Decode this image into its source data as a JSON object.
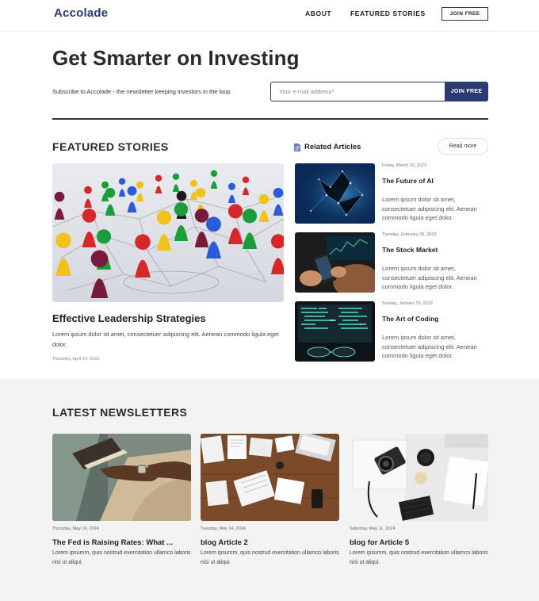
{
  "nav": {
    "logo": "Accolade",
    "about": "ABOUT",
    "featured_stories": "FEATURED STORIES",
    "join_free": "JOIN FREE"
  },
  "hero": {
    "title": "Get Smarter on Investing",
    "subtitle": "Subscribe to Accolade - the newsletter keeping investors in the loop",
    "email_placeholder": "Your e-mail address*",
    "email_value": "",
    "join_button": "JOIN FREE"
  },
  "featured": {
    "section_title": "FEATURED STORIES",
    "image_icon": "game-pieces-network-image",
    "article_title": "Effective Leadership Strategies",
    "article_desc": "Lorem ipsum dolor sit amet, consectetuer adipiscing elit. Aenean commodo ligula eget dolor.",
    "article_date": "Thursday, April 20, 2023"
  },
  "related": {
    "label": "Related Articles",
    "icon": "document-icon",
    "read_more": "Read more",
    "items": [
      {
        "date": "Friday, March 10, 2023",
        "title": "The Future of AI",
        "desc": "Lorem ipsum dolor sit amet, consectetuer adipiscing elit. Aenean commodo ligula eget dolor.",
        "image": "ai-network-image"
      },
      {
        "date": "Tuesday, February 28, 2023",
        "title": "The Stock Market",
        "desc": "Lorem ipsum dolor sit amet, consectetuer adipiscing elit. Aenean commodo ligula eget dolor.",
        "image": "stock-phone-image"
      },
      {
        "date": "Sunday, January 15, 2023",
        "title": "The Art of Coding",
        "desc": "Lorem ipsum dolor sit amet, consectetuer adipiscing elit. Aenean commodo ligula eget dolor.",
        "image": "code-monitor-image"
      }
    ]
  },
  "latest": {
    "section_title": "LATEST NEWSLETTERS",
    "cards": [
      {
        "date": "Thursday, May 16, 2024",
        "title": "The Fed is Raising Rates: What ...",
        "desc": "Lorem ipsumm, quis nostrud exercitation ullamco laboris nisi ut aliqui.",
        "image": "reading-book-image"
      },
      {
        "date": "Tuesday, May 14, 2024",
        "title": "blog Article 2",
        "desc": "Lorem ipsumm, quis nostrud exercitation ullamco laboris nisi ut aliqui.",
        "image": "desk-papers-image"
      },
      {
        "date": "Saturday, May 11, 2024",
        "title": "blog for Article 5",
        "desc": "Lorem ipsumm, quis nostrud exercitation ullamco laboris nisi ut aliqui.",
        "image": "camera-desk-image"
      }
    ]
  },
  "colors": {
    "brand": "#2b3a73",
    "text": "#222222",
    "section_bg": "#f3f3f3"
  }
}
